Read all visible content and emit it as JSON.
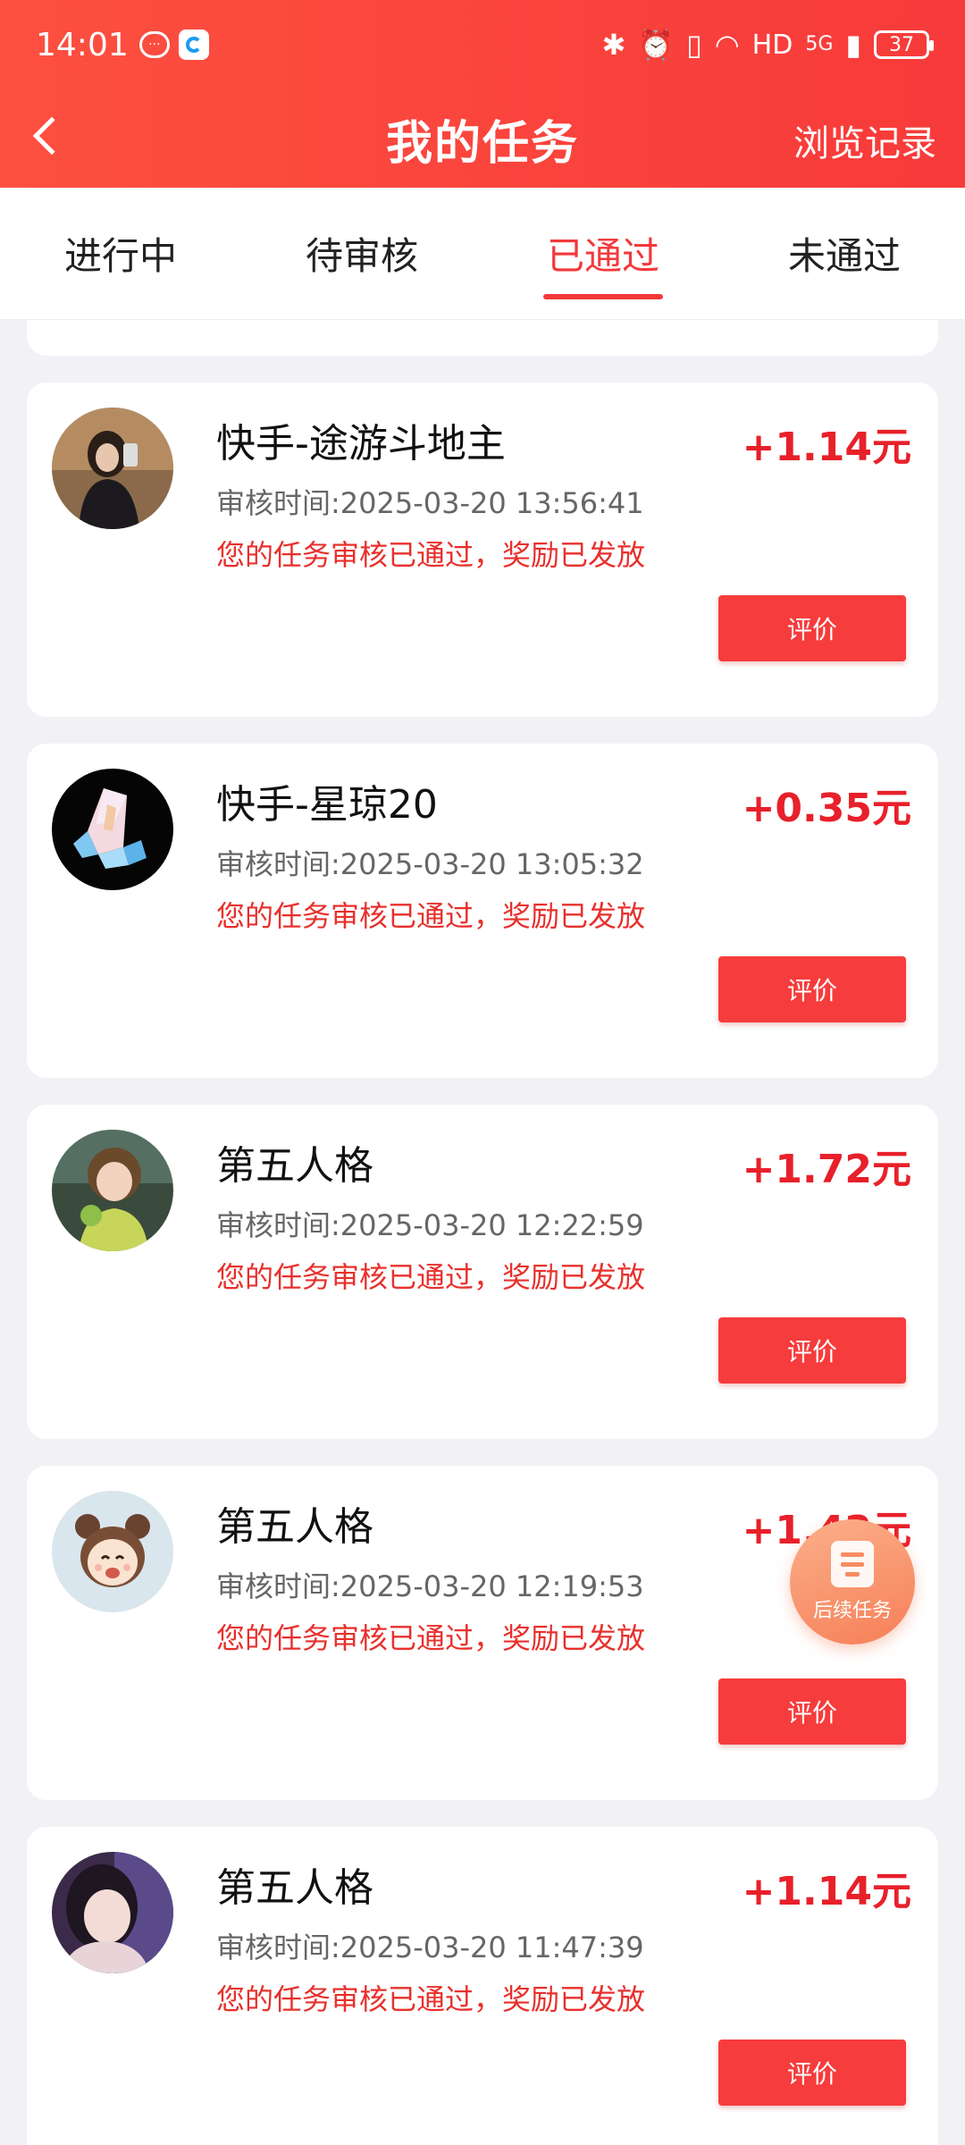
{
  "status_bar": {
    "time": "14:01",
    "network": "HD",
    "signal": "5G",
    "battery": "37"
  },
  "header": {
    "title": "我的任务",
    "history": "浏览记录"
  },
  "tabs": [
    {
      "label": "进行中",
      "active": false
    },
    {
      "label": "待审核",
      "active": false
    },
    {
      "label": "已通过",
      "active": true
    },
    {
      "label": "未通过",
      "active": false
    }
  ],
  "tasks": [
    {
      "name": "快手-途游斗地主",
      "reward": "+1.14元",
      "review_time": "审核时间:2025-03-20 13:56:41",
      "status": "您的任务审核已通过，奖励已发放",
      "button": "评价",
      "avatar_icon": "portrait-photo"
    },
    {
      "name": "快手-星琼20",
      "reward": "+0.35元",
      "review_time": "审核时间:2025-03-20 13:05:32",
      "status": "您的任务审核已通过，奖励已发放",
      "button": "评价",
      "avatar_icon": "crystal-image"
    },
    {
      "name": "第五人格",
      "reward": "+1.72元",
      "review_time": "审核时间:2025-03-20 12:22:59",
      "status": "您的任务审核已通过，奖励已发放",
      "button": "评价",
      "avatar_icon": "portrait-photo"
    },
    {
      "name": "第五人格",
      "reward": "+1.42元",
      "review_time": "审核时间:2025-03-20 12:19:53",
      "status": "您的任务审核已通过，奖励已发放",
      "button": "评价",
      "avatar_icon": "cartoon-girl"
    },
    {
      "name": "第五人格",
      "reward": "+1.14元",
      "review_time": "审核时间:2025-03-20 11:47:39",
      "status": "您的任务审核已通过，奖励已发放",
      "button": "评价",
      "avatar_icon": "portrait-photo"
    }
  ],
  "floating_button": {
    "label": "后续任务"
  },
  "colors": {
    "brand": "#f73a3a",
    "reward": "#e8202a",
    "fab": "#f67f58"
  }
}
